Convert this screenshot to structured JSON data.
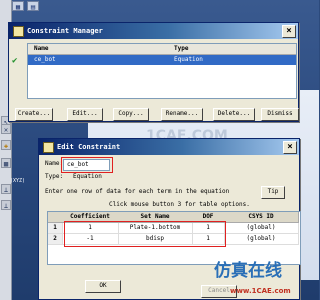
{
  "constraint_manager": {
    "title": "Constraint Manager",
    "columns": [
      "Name",
      "Type"
    ],
    "rows": [
      {
        "name": "ce_bot",
        "type": "Equation"
      }
    ],
    "buttons": [
      "Create...",
      "Edit...",
      "Copy...",
      "Rename...",
      "Delete...",
      "Dismiss"
    ]
  },
  "edit_constraint": {
    "title": "Edit Constraint",
    "name_label": "Name:",
    "name_value": "ce_bot",
    "type_label": "Type:",
    "type_value": "Equation",
    "instruction": "Enter one row of data for each term in the equation",
    "tip_label": "Tip",
    "table_hint": "Click mouse button 3 for table options.",
    "columns": [
      "Coefficient",
      "Set Name",
      "DOF",
      "CSYS ID"
    ],
    "rows": [
      {
        "index": "1",
        "coefficient": "1",
        "set_name": "Plate-1.bottom",
        "dof": "1",
        "csys": "(global)"
      },
      {
        "index": "2",
        "coefficient": "-1",
        "set_name": "bdisp",
        "dof": "1",
        "csys": "(global)"
      }
    ],
    "ok_label": "OK",
    "cancel_label": "Cancel"
  },
  "watermark": {
    "text": "1CAE.COM",
    "chinese": "仿真在线",
    "site": "www.1CAE.com"
  },
  "toolbar": {
    "icons": [
      "select-icon",
      "constraint-icon",
      "coupling-icon",
      "axis-icon",
      "tie-icon"
    ],
    "axis_label": "(XYZ)"
  }
}
